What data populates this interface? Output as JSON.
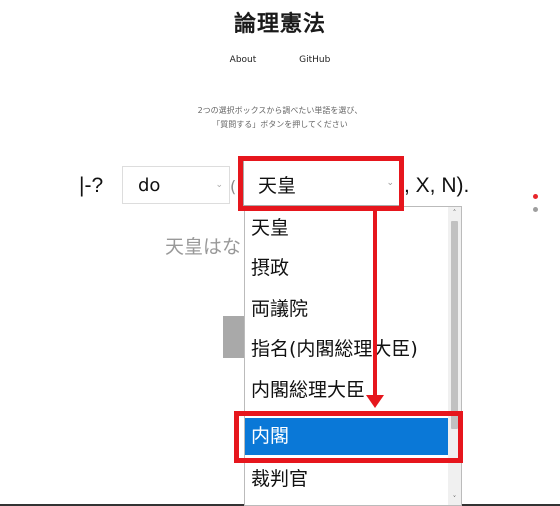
{
  "site": {
    "title": "論理憲法",
    "nav": [
      {
        "label": "About"
      },
      {
        "label": "GitHub"
      }
    ],
    "description_line1": "2つの選択ボックスから調べたい単語を選び、",
    "description_line2": "「質問する」ボタンを押してください"
  },
  "query": {
    "prefix": "|-?",
    "select1_value": "do",
    "open_paren": "(",
    "select2_value": "天皇",
    "suffix": ", X, N).",
    "chevron": "⌄"
  },
  "result": {
    "text": "天皇はな"
  },
  "dropdown": {
    "selected_index": 5,
    "options": [
      {
        "label": "天皇"
      },
      {
        "label": "摂政"
      },
      {
        "label": "両議院"
      },
      {
        "label": "指名(内閣総理大臣)"
      },
      {
        "label": "内閣総理大臣"
      },
      {
        "label": "内閣"
      },
      {
        "label": "裁判官"
      }
    ],
    "scroll_up": "˄",
    "scroll_down": "˅"
  },
  "colors": {
    "highlight": "#e6161d",
    "selected_option_bg": "#0a78d7",
    "dot_red": "#e8262b",
    "dot_gray": "#9e9e9e"
  }
}
